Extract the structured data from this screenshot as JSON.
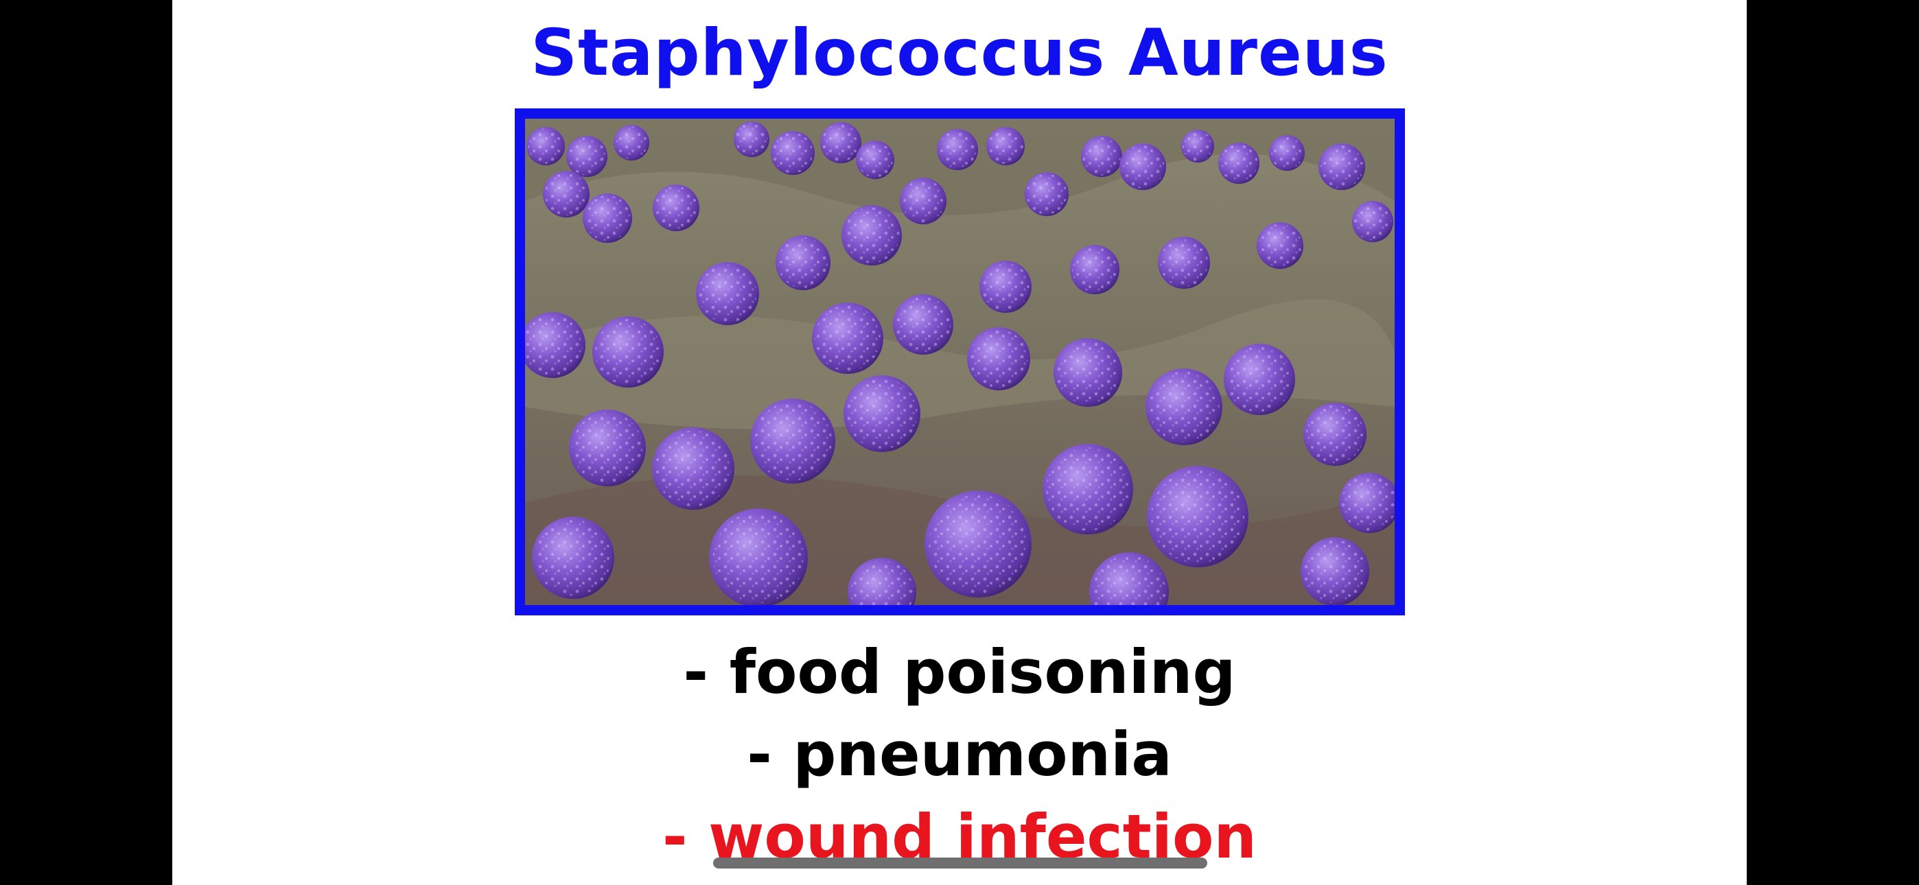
{
  "slide": {
    "title": "Staphylococcus Aureus",
    "title_color": "#1010ee",
    "image_subject": "purple spherical Staphylococcus aureus bacteria on tissue surface",
    "image_border_color": "#1010ee",
    "bullets": [
      {
        "text": "- food poisoning",
        "color": "#000000"
      },
      {
        "text": "- pneumonia",
        "color": "#000000"
      },
      {
        "text": "- wound infection",
        "color": "#e8141e"
      }
    ]
  },
  "colors": {
    "background": "#ffffff",
    "letterbox": "#000000",
    "bacteria": "#7a4fc4",
    "tissue": "#7d7963"
  }
}
